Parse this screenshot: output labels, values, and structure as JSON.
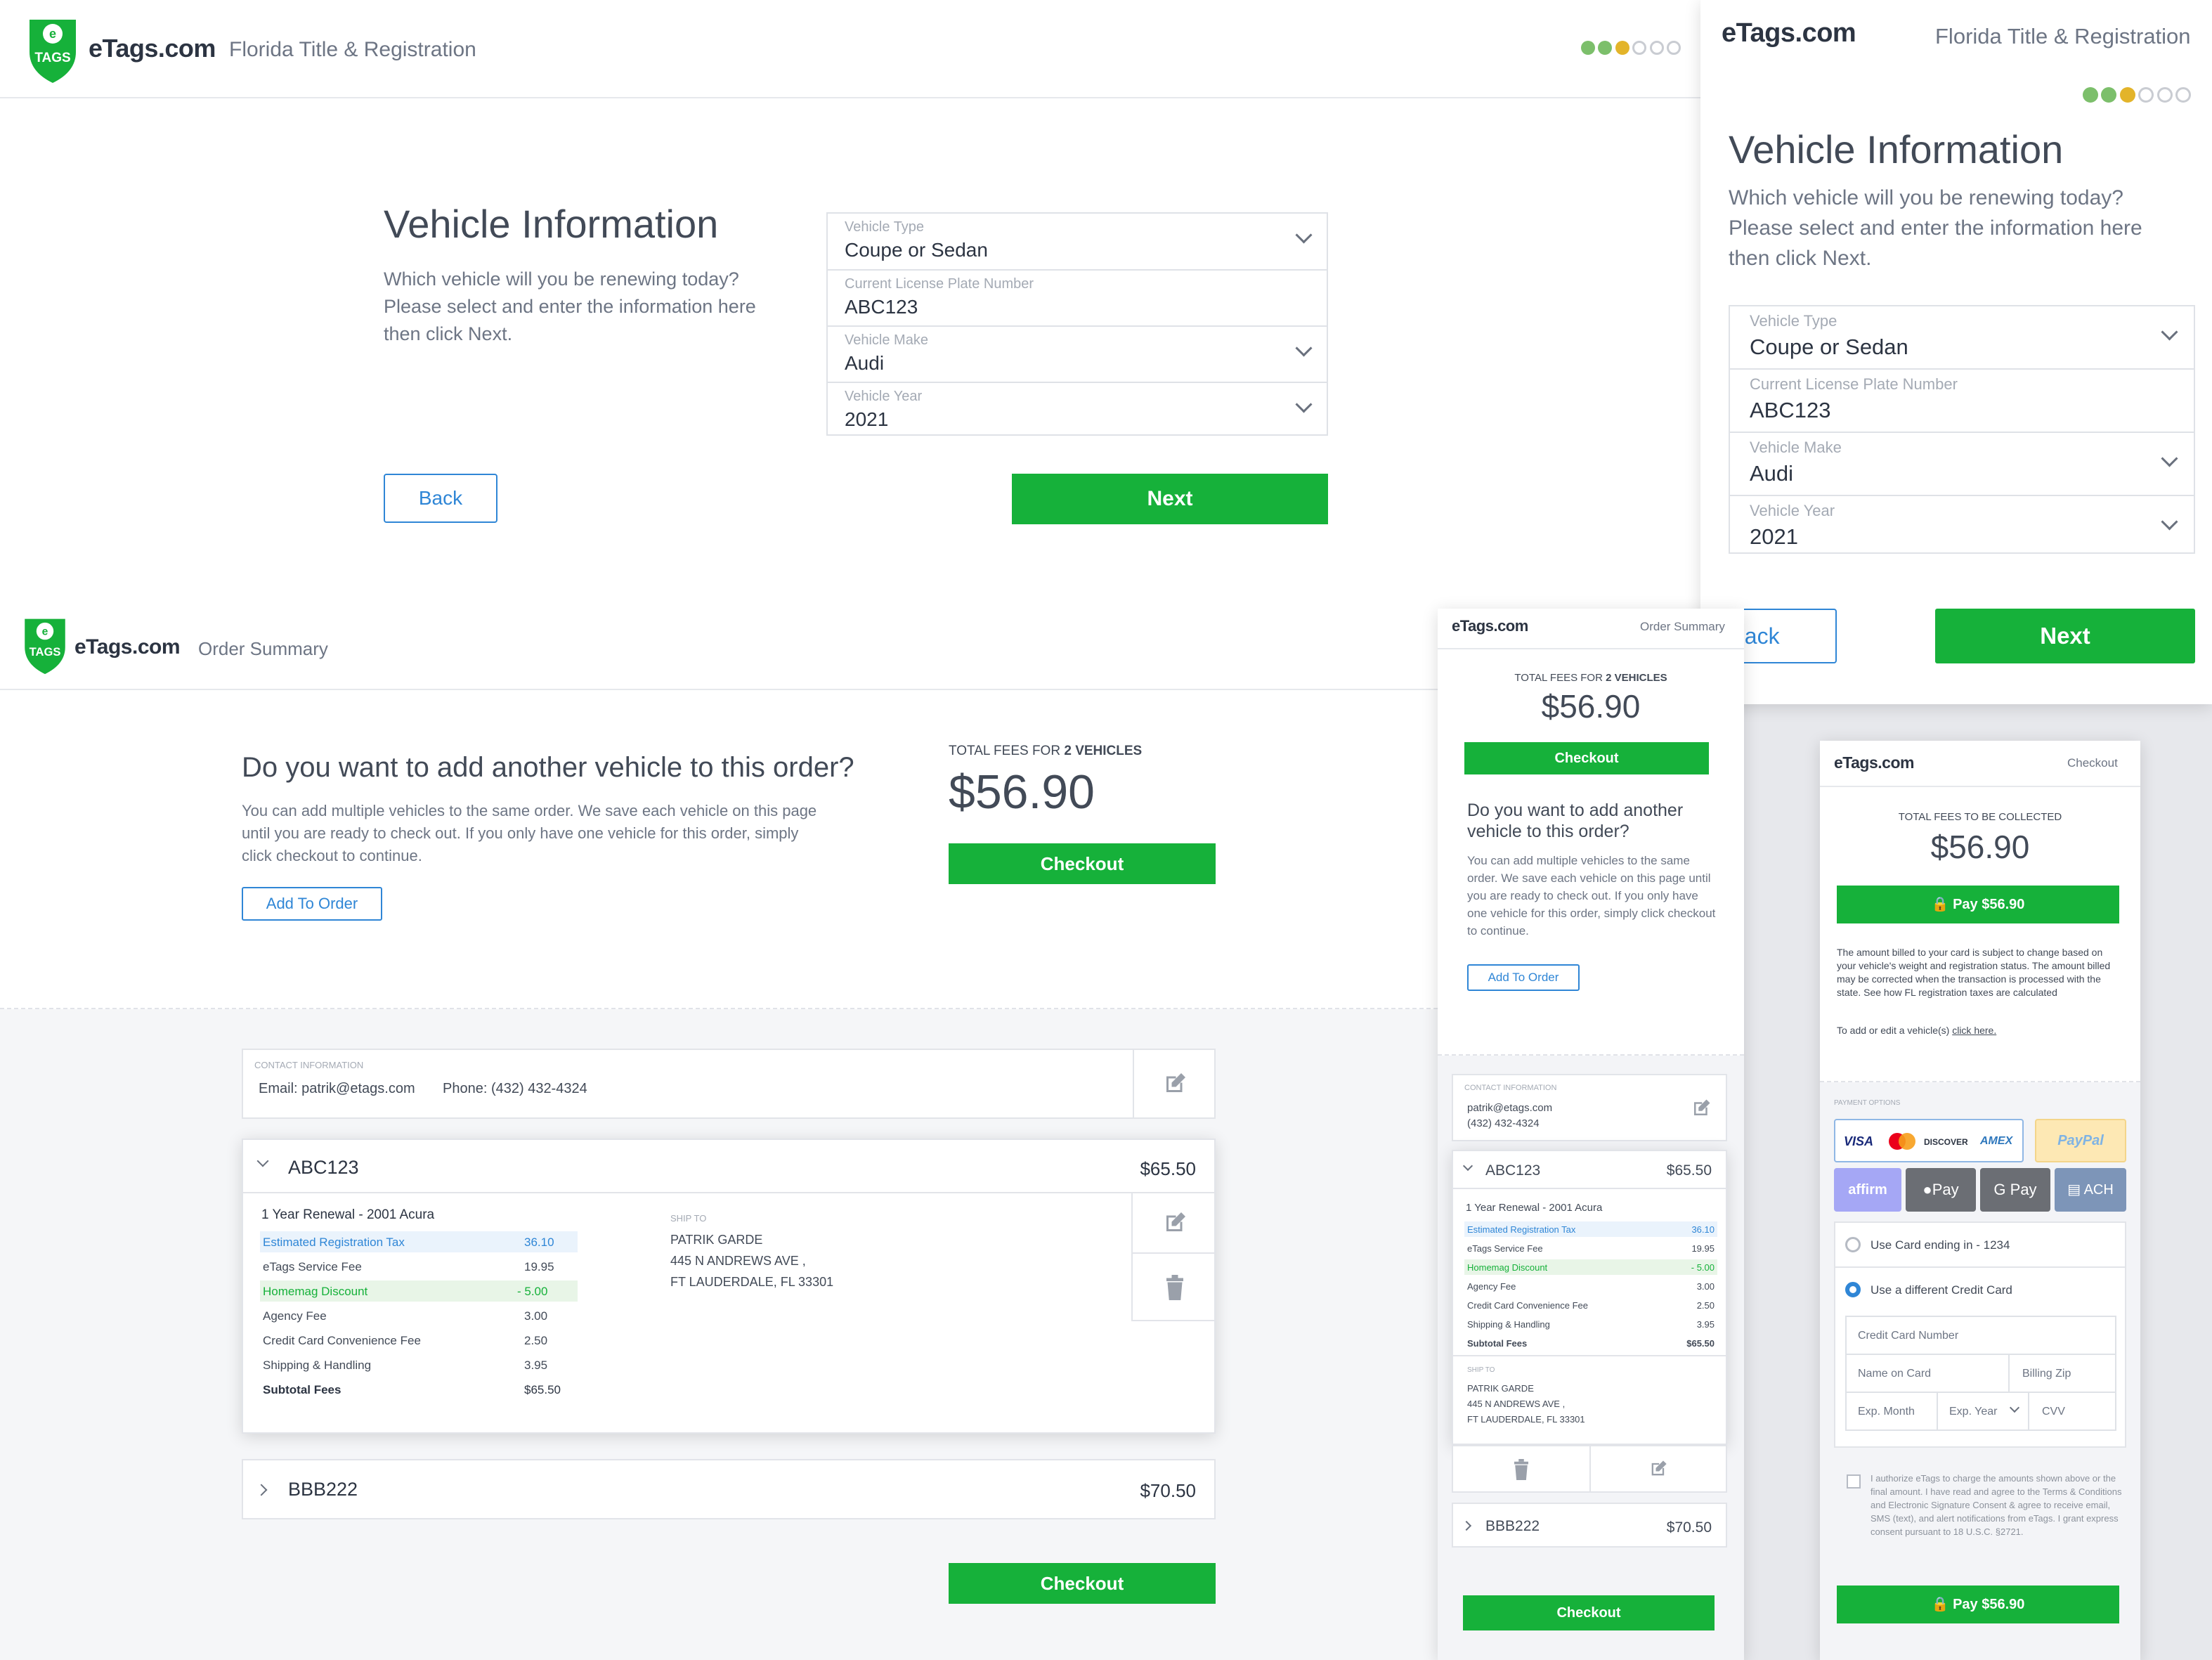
{
  "brand": {
    "name": "eTags.com",
    "logo_text": "TAGS",
    "accent": "#16b13a",
    "link": "#2f86d6"
  },
  "vehicle_desktop": {
    "header_subtitle": "Florida Title & Registration",
    "title": "Vehicle Information",
    "description": "Which vehicle will you be renewing today? Please select and enter the information here then click Next.",
    "fields": [
      {
        "label": "Vehicle Type",
        "value": "Coupe or Sedan"
      },
      {
        "label": "Current License Plate Number",
        "value": "ABC123"
      },
      {
        "label": "Vehicle Make",
        "value": "Audi"
      },
      {
        "label": "Vehicle Year",
        "value": "2021"
      }
    ],
    "back": "Back",
    "next": "Next"
  },
  "vehicle_mobile": {
    "header_subtitle": "Florida Title & Registration",
    "title": "Vehicle Information",
    "description": "Which vehicle will you be renewing today? Please select and enter the information here then click Next.",
    "fields": [
      {
        "label": "Vehicle Type",
        "value": "Coupe or Sedan"
      },
      {
        "label": "Current License Plate Number",
        "value": "ABC123"
      },
      {
        "label": "Vehicle Make",
        "value": "Audi"
      },
      {
        "label": "Vehicle Year",
        "value": "2021"
      }
    ],
    "back": "Back",
    "next": "Next"
  },
  "order_desktop": {
    "header_subtitle": "Order Summary",
    "question": "Do you want to add another vehicle to this order?",
    "description": "You can add multiple vehicles to the same order. We save each vehicle on this page until you are ready to check out. If you only have one vehicle for this order, simply click checkout to continue.",
    "add_button": "Add To Order",
    "total_label_prefix": "TOTAL FEES FOR",
    "total_label_count": "2 VEHICLES",
    "total": "$56.90",
    "checkout": "Checkout",
    "contact_label": "CONTACT INFORMATION",
    "contact_email": "Email: patrik@etags.com",
    "contact_phone": "Phone: (432) 432-4324",
    "vehicle1": {
      "plate": "ABC123",
      "amount": "$65.50",
      "title": "1 Year Renewal - 2001 Acura",
      "items": [
        {
          "label": "Estimated Registration Tax",
          "value": "36.10"
        },
        {
          "label": "eTags Service Fee",
          "value": "19.95"
        },
        {
          "label": "Homemag Discount",
          "value": "- 5.00"
        },
        {
          "label": "Agency Fee",
          "value": "3.00"
        },
        {
          "label": "Credit Card Convenience Fee",
          "value": "2.50"
        },
        {
          "label": "Shipping & Handling",
          "value": "3.95"
        },
        {
          "label": "Subtotal Fees",
          "value": "$65.50"
        }
      ],
      "ship_label": "SHIP TO",
      "ship_name": "PATRIK GARDE",
      "ship_street": "445 N ANDREWS AVE ,",
      "ship_city": "FT LAUDERDALE, FL 33301"
    },
    "vehicle2": {
      "plate": "BBB222",
      "amount": "$70.50"
    }
  },
  "order_mobile": {
    "brand": "eTags.com",
    "header_subtitle": "Order Summary",
    "total_label_prefix": "TOTAL FEES FOR",
    "total_label_count": "2 VEHICLES",
    "total": "$56.90",
    "checkout": "Checkout",
    "question": "Do you want to add another vehicle to this order?",
    "description": "You can add multiple vehicles to the same order. We save each vehicle on this page until you are ready to check out. If you only have one vehicle for this order, simply click checkout to continue.",
    "add_button": "Add To Order",
    "contact_label": "CONTACT INFORMATION",
    "contact_email": "patrik@etags.com",
    "contact_phone": "(432) 432-4324",
    "vehicle1": {
      "plate": "ABC123",
      "amount": "$65.50",
      "title": "1 Year Renewal - 2001 Acura",
      "items": [
        {
          "label": "Estimated Registration Tax",
          "value": "36.10"
        },
        {
          "label": "eTags Service Fee",
          "value": "19.95"
        },
        {
          "label": "Homemag Discount",
          "value": "- 5.00"
        },
        {
          "label": "Agency Fee",
          "value": "3.00"
        },
        {
          "label": "Credit Card Convenience Fee",
          "value": "2.50"
        },
        {
          "label": "Shipping & Handling",
          "value": "3.95"
        },
        {
          "label": "Subtotal Fees",
          "value": "$65.50"
        }
      ],
      "ship_label": "SHIP TO",
      "ship_name": "PATRIK GARDE",
      "ship_street": "445 N ANDREWS AVE ,",
      "ship_city": "FT LAUDERDALE, FL 33301"
    },
    "vehicle2": {
      "plate": "BBB222",
      "amount": "$70.50"
    }
  },
  "checkout_mobile": {
    "brand": "eTags.com",
    "header_subtitle": "Checkout",
    "total_label": "TOTAL FEES TO BE COLLECTED",
    "total": "$56.90",
    "pay_button": "Pay $56.90",
    "notice": "The amount billed to your card is subject to change based on your vehicle's weight and registration status. The amount billed may be corrected when the transaction is processed with the state. See how FL registration taxes are calculated",
    "add_edit_text": "To add or edit a vehicle(s)",
    "add_edit_link": "click here.",
    "payment_options_label": "PAYMENT OPTIONS",
    "payment_methods": [
      "VISA",
      "MC",
      "DISCOVER",
      "AMEX",
      "PayPal",
      "affirm",
      "Pay",
      "G Pay",
      "ACH"
    ],
    "saved_card": "Use Card ending in - 1234",
    "new_card": "Use a different Credit Card",
    "card_number": "Credit Card Number",
    "name_on_card": "Name on Card",
    "billing_zip": "Billing Zip",
    "exp_month": "Exp. Month",
    "exp_year": "Exp. Year",
    "cvv": "CVV",
    "authorize": "I authorize eTags to charge the amounts shown above or the final amount. I have read and agree to the Terms & Conditions and Electronic Signature Consent & agree to receive email, SMS (text), and alert notifications from eTags. I grant express consent pursuant to 18 U.S.C. §2721."
  }
}
